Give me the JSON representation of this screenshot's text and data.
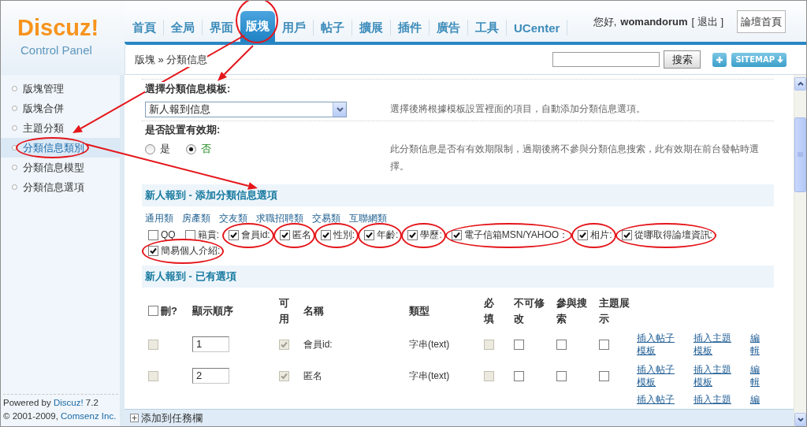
{
  "logo": {
    "title": "Discuz!",
    "subtitle": "Control Panel"
  },
  "nav": {
    "tabs": [
      {
        "label": "首頁",
        "selected": false,
        "circled": false
      },
      {
        "label": "全局",
        "selected": false,
        "circled": false
      },
      {
        "label": "界面",
        "selected": false,
        "circled": false
      },
      {
        "label": "版塊",
        "selected": true,
        "circled": true
      },
      {
        "label": "用戶",
        "selected": false,
        "circled": false
      },
      {
        "label": "帖子",
        "selected": false,
        "circled": false
      },
      {
        "label": "擴展",
        "selected": false,
        "circled": false
      },
      {
        "label": "插件",
        "selected": false,
        "circled": false
      },
      {
        "label": "廣告",
        "selected": false,
        "circled": false
      },
      {
        "label": "工具",
        "selected": false,
        "circled": false
      },
      {
        "label": "UCenter",
        "selected": false,
        "circled": false
      }
    ],
    "user": {
      "greeting": "您好,",
      "username": "womandorum",
      "logout": "[ 退出 ]"
    },
    "home_button": "論壇首頁"
  },
  "toolbar": {
    "breadcrumb": "版塊 » 分類信息",
    "search_button": "搜索",
    "sitemap_button": "SITEMAP"
  },
  "sidebar": {
    "items": [
      {
        "label": "版塊管理",
        "selected": false,
        "circled": false
      },
      {
        "label": "版塊合併",
        "selected": false,
        "circled": false
      },
      {
        "label": "主題分類",
        "selected": false,
        "circled": false
      },
      {
        "label": "分類信息類別",
        "selected": true,
        "circled": true
      },
      {
        "label": "分類信息模型",
        "selected": false,
        "circled": false
      },
      {
        "label": "分類信息選項",
        "selected": false,
        "circled": false
      }
    ],
    "footer": {
      "powered_by": {
        "before": "Powered by",
        "link": "Discuz!",
        "after": "7.2"
      },
      "copyright": {
        "before": "© 2001-2009,",
        "link": "Comsenz Inc."
      }
    }
  },
  "template_setting": {
    "title": "選擇分類信息模板:",
    "value": "新人報到信息",
    "hint": "選擇後將根據模板設置裡面的項目，自動添加分類信息選項。"
  },
  "expiry_setting": {
    "title": "是否設置有效期:",
    "options": [
      {
        "label": "是",
        "selected": false
      },
      {
        "label": "否",
        "selected": true
      }
    ],
    "hint": "此分類信息是否有有效期限制，過期後將不參與分類信息搜索，此有效期在前台發帖時選擇。"
  },
  "add_options": {
    "title": "新人報到 - 添加分類信息選項",
    "categories": [
      "通用類",
      "房產類",
      "交友類",
      "求職招聘類",
      "交易類",
      "互聯網類"
    ],
    "options": [
      {
        "label": "QQ",
        "checked": false,
        "circled": false
      },
      {
        "label": "籍貫:",
        "checked": false,
        "circled": false
      },
      {
        "label": "會員id:",
        "checked": true,
        "circled": true
      },
      {
        "label": "匿名",
        "checked": true,
        "circled": true
      },
      {
        "label": "性別:",
        "checked": true,
        "circled": true
      },
      {
        "label": "年齡:",
        "checked": true,
        "circled": true
      },
      {
        "label": "學歷:",
        "checked": true,
        "circled": true
      },
      {
        "label": "電子信箱MSN/YAHOO：",
        "checked": true,
        "circled": true
      },
      {
        "label": "相片:",
        "checked": true,
        "circled": true
      },
      {
        "label": "從哪取得論壇資訊:",
        "checked": true,
        "circled": true
      },
      {
        "label": "簡易個人介紹:",
        "checked": true,
        "circled": true
      }
    ]
  },
  "existing_options": {
    "title": "新人報到 - 已有選項",
    "select_all": {
      "checked": false
    },
    "columns": [
      "刪?",
      "顯示順序",
      "可用",
      "名稱",
      "類型",
      "必填",
      "不可修改",
      "參與搜索",
      "主題展示"
    ],
    "rows": [
      {
        "delete": {
          "checked": false,
          "disabled": true
        },
        "order": "1",
        "enabled": {
          "checked": true,
          "disabled": true
        },
        "name": "會員id:",
        "type": "字串(text)",
        "required": {
          "checked": false,
          "disabled": true
        },
        "locked": {
          "checked": false,
          "disabled": false
        },
        "searchable": {
          "checked": false,
          "disabled": false
        },
        "featured": {
          "checked": false,
          "disabled": false
        },
        "links": [
          "插入帖子模板",
          "插入主題模板",
          "編輯"
        ]
      },
      {
        "delete": {
          "checked": false,
          "disabled": true
        },
        "order": "2",
        "enabled": {
          "checked": true,
          "disabled": true
        },
        "name": "匿名",
        "type": "字串(text)",
        "required": {
          "checked": false,
          "disabled": true
        },
        "locked": {
          "checked": false,
          "disabled": false
        },
        "searchable": {
          "checked": false,
          "disabled": false
        },
        "featured": {
          "checked": false,
          "disabled": false
        },
        "links": [
          "插入帖子模板",
          "插入主題模板",
          "編輯"
        ]
      },
      {
        "links": [
          "插入帖子",
          "插入主題",
          "編"
        ]
      }
    ]
  },
  "taskbar": {
    "label": "添加到任務欄"
  }
}
